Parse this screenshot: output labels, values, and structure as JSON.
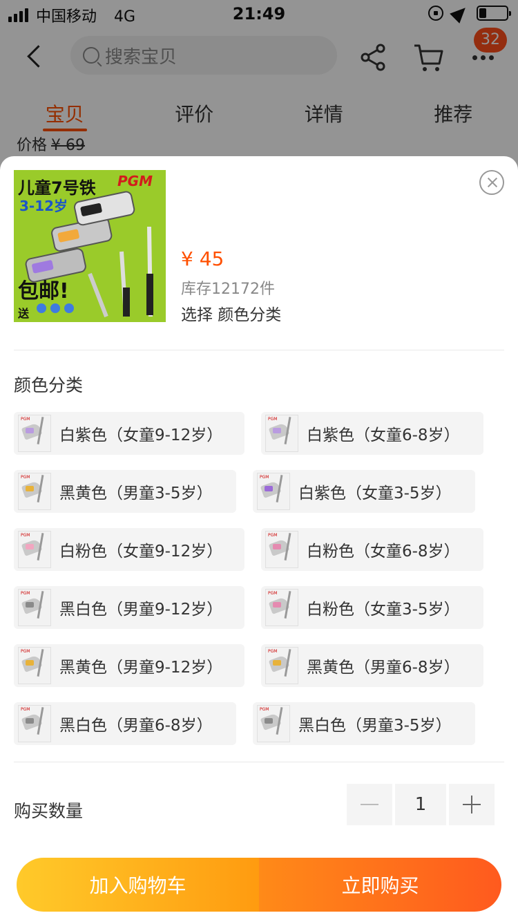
{
  "status_bar": {
    "carrier": "中国移动",
    "network": "4G",
    "time": "21:49"
  },
  "header": {
    "search_placeholder": "搜索宝贝",
    "cart_badge": "32"
  },
  "tabs": [
    {
      "label": "宝贝",
      "active": true
    },
    {
      "label": "评价",
      "active": false
    },
    {
      "label": "详情",
      "active": false
    },
    {
      "label": "推荐",
      "active": false
    }
  ],
  "price_peek": {
    "label": "价格",
    "value": "¥ 69"
  },
  "product": {
    "image_text": {
      "line1": "儿童7号铁",
      "brand": "PGM",
      "ages": "3-12岁",
      "promo": "包邮!",
      "gift": "送"
    },
    "price": "¥ 45",
    "stock": "库存12172件",
    "selection": "选择  颜色分类"
  },
  "variants": {
    "title": "颜色分类",
    "options": [
      {
        "label": "白紫色（女童9-12岁）",
        "accent": "#b99be0"
      },
      {
        "label": "白紫色（女童6-8岁）",
        "accent": "#b99be0"
      },
      {
        "label": "黑黄色（男童3-5岁）",
        "accent": "#e8b23a"
      },
      {
        "label": "白紫色（女童3-5岁）",
        "accent": "#9b6ad8"
      },
      {
        "label": "白粉色（女童9-12岁）",
        "accent": "#f2a6c0"
      },
      {
        "label": "白粉色（女童6-8岁）",
        "accent": "#e58ab0"
      },
      {
        "label": "黑白色（男童9-12岁）",
        "accent": "#8a8a8a"
      },
      {
        "label": "白粉色（女童3-5岁）",
        "accent": "#e58ab0"
      },
      {
        "label": "黑黄色（男童9-12岁）",
        "accent": "#e8b23a"
      },
      {
        "label": "黑黄色（男童6-8岁）",
        "accent": "#e8b23a"
      },
      {
        "label": "黑白色（男童6-8岁）",
        "accent": "#8a8a8a"
      },
      {
        "label": "黑白色（男童3-5岁）",
        "accent": "#8a8a8a"
      }
    ]
  },
  "quantity": {
    "label": "购买数量",
    "value": "1"
  },
  "actions": {
    "add_to_cart": "加入购物车",
    "buy_now": "立即购买"
  },
  "icons": [
    "signal-icon",
    "rotation-lock-icon",
    "location-icon",
    "battery-icon",
    "back-icon",
    "search-icon",
    "share-icon",
    "cart-icon",
    "more-icon",
    "close-icon",
    "minus-icon",
    "plus-icon"
  ],
  "colors": {
    "accent": "#ff5000",
    "cart_button": "#ffb01c",
    "buy_button": "#ff6a1a"
  }
}
